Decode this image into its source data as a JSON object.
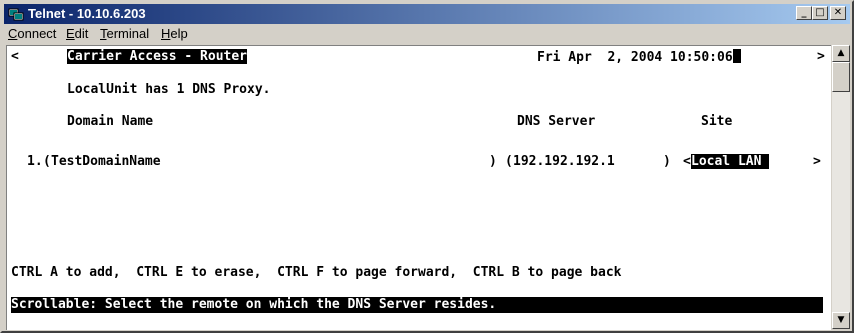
{
  "window": {
    "title": "Telnet - 10.10.6.203",
    "minimize_glyph": "_",
    "maximize_glyph": "□",
    "close_glyph": "✕"
  },
  "menu": {
    "connect": {
      "first": "C",
      "rest": "onnect"
    },
    "edit": {
      "first": "E",
      "rest": "dit"
    },
    "terminal": {
      "first": "T",
      "rest": "erminal"
    },
    "help": {
      "first": "H",
      "rest": "elp"
    }
  },
  "terminal": {
    "left_arrow": "<",
    "right_arrow": ">",
    "header_title": "Carrier Access - Router",
    "datetime": "Fri Apr  2, 2004 10:50:06",
    "proxy_info": "LocalUnit has 1 DNS Proxy.",
    "col_domain": "Domain Name",
    "col_dns": "DNS Server",
    "col_site": "Site",
    "row_index": "1.",
    "row_domain_open": "(",
    "row_domain": "TestDomainName",
    "row_domain_close": ")",
    "row_dns_open": "(",
    "row_dns": "192.192.192.1",
    "row_dns_close": ")",
    "row_site_open": "<",
    "row_site": "Local LAN ",
    "row_site_close": ">",
    "help_line": "CTRL A to add,  CTRL E to erase,  CTRL F to page forward,  CTRL B to page back",
    "status_line": "Scrollable: Select the remote on which the DNS Server resides."
  },
  "scrollbar": {
    "up_glyph": "▲",
    "down_glyph": "▼"
  },
  "icons": {
    "title": "telnet-app-icon"
  }
}
